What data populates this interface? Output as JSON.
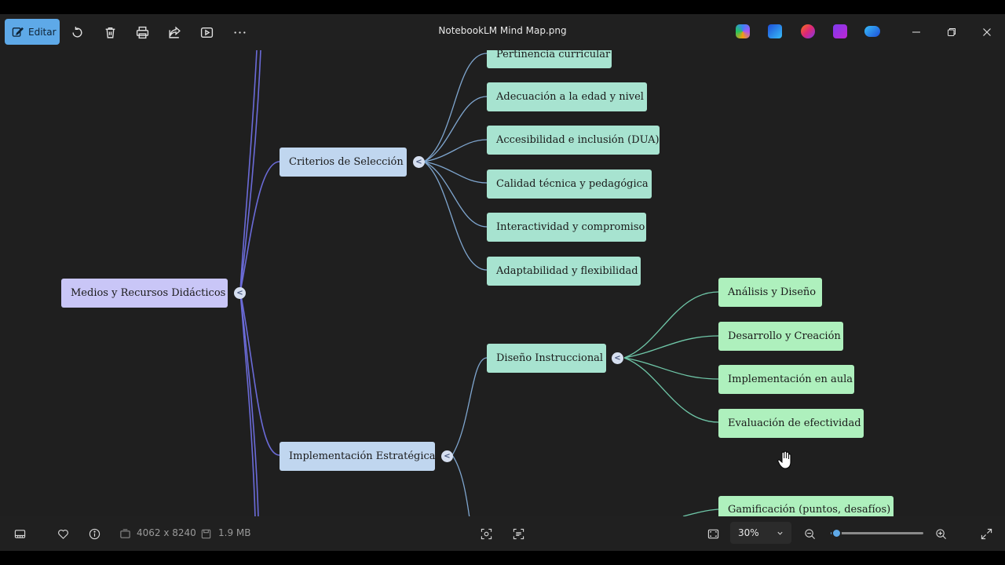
{
  "titlebar": {
    "edit_label": "Editar",
    "title": "NotebookLM Mind Map.png"
  },
  "mindmap": {
    "root": "Medios y Recursos Didácticos",
    "criterios": {
      "label": "Criterios de Selección",
      "children": [
        "Pertinencia curricular",
        "Adecuación a la edad y nivel",
        "Accesibilidad e inclusión (DUA)",
        "Calidad técnica y pedagógica",
        "Interactividad y compromiso",
        "Adaptabilidad y flexibilidad"
      ]
    },
    "implementacion": {
      "label": "Implementación Estratégica",
      "diseno": {
        "label": "Diseño Instruccional",
        "children": [
          "Análisis y Diseño",
          "Desarrollo y Creación",
          "Implementación en aula",
          "Evaluación de efectividad"
        ]
      },
      "gamificacion": "Gamificación (puntos, desafíos)"
    },
    "toggle_glyph": "<"
  },
  "bottombar": {
    "dimensions": "4062 x 8240",
    "filesize": "1.9 MB",
    "zoom": "30%",
    "zoom_fraction": 0.06
  },
  "colors": {
    "accent": "#5ea9e8",
    "root_node": "#c9c6f7",
    "level1_node": "#c0d6ef",
    "level2_node": "#a7e3d0",
    "level3_node": "#aef0bd",
    "root_links": "#6b6bd8",
    "level1_links": "#7fa6cf",
    "level2_links": "#6fc7a8"
  }
}
